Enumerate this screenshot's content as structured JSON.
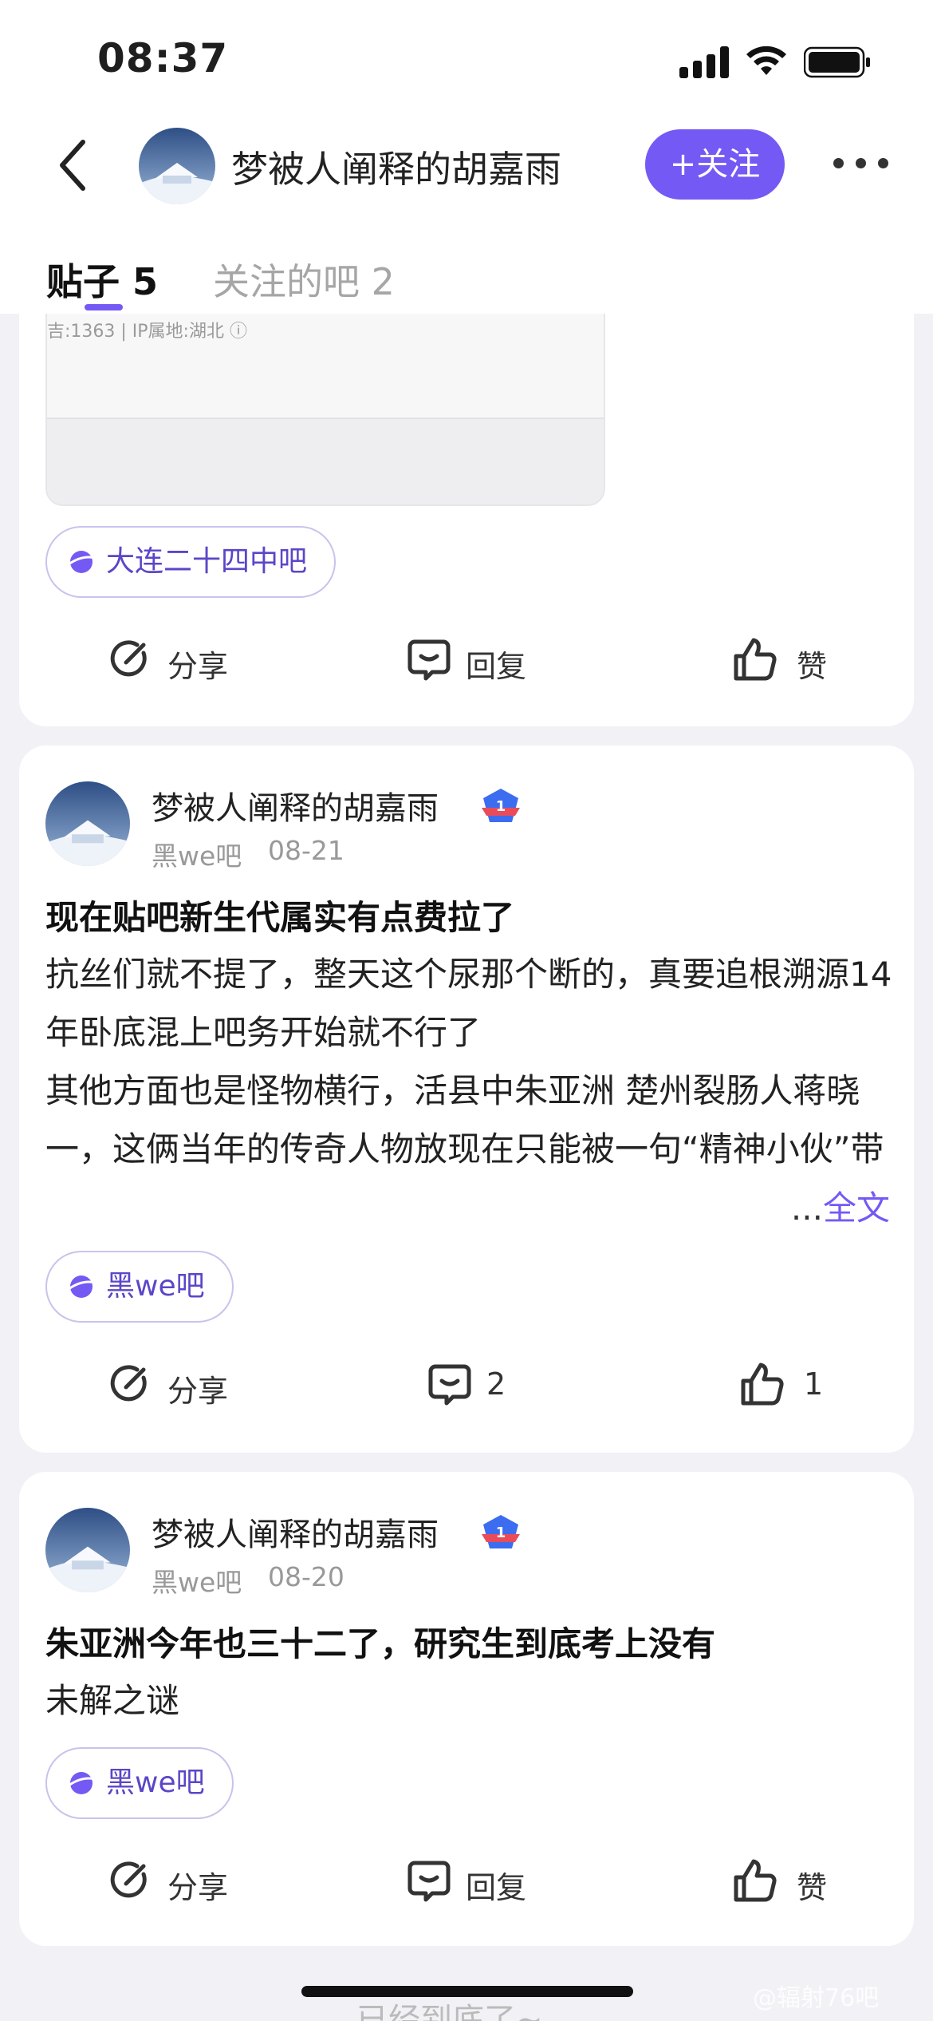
{
  "status": {
    "time": "08:37"
  },
  "header": {
    "username": "梦被人阐释的胡嘉雨",
    "follow_label": "+关注"
  },
  "tabs": [
    {
      "label": "贴子 5"
    },
    {
      "label": "关注的吧 2"
    }
  ],
  "card1": {
    "preview_meta": "吉:1363  |  IP属地:湖北 ⓘ",
    "forum": "大连二十四中吧",
    "share": "分享",
    "reply": "回复",
    "like": "赞"
  },
  "post1": {
    "author": "梦被人阐释的胡嘉雨",
    "forum_src": "黑we吧",
    "date": "08-21",
    "title": "现在贴吧新生代属实有点费拉了",
    "body": "抗丝们就不提了，整天这个尿那个断的，真要追根溯源14年卧底混上吧务开始就不行了\n其他方面也是怪物横行，活县中朱亚洲 楚州裂肠人蒋晓一，这俩当年的传奇人物放现在只能被一句“精神小伙”带过",
    "more_dots": "...",
    "more_label": "全文",
    "forum": "黑we吧",
    "share": "分享",
    "reply_count": "2",
    "like_count": "1"
  },
  "post2": {
    "author": "梦被人阐释的胡嘉雨",
    "forum_src": "黑we吧",
    "date": "08-20",
    "title": "朱亚洲今年也三十二了，研究生到底考上没有",
    "body": "未解之谜",
    "forum": "黑we吧",
    "share": "分享",
    "reply": "回复",
    "like": "赞"
  },
  "footer": {
    "end_text": "已经到底了~",
    "watermark": "@辐射76吧"
  },
  "colors": {
    "accent": "#7559f4",
    "chip_border": "#c9c3ec",
    "background": "#f2f2f6"
  }
}
